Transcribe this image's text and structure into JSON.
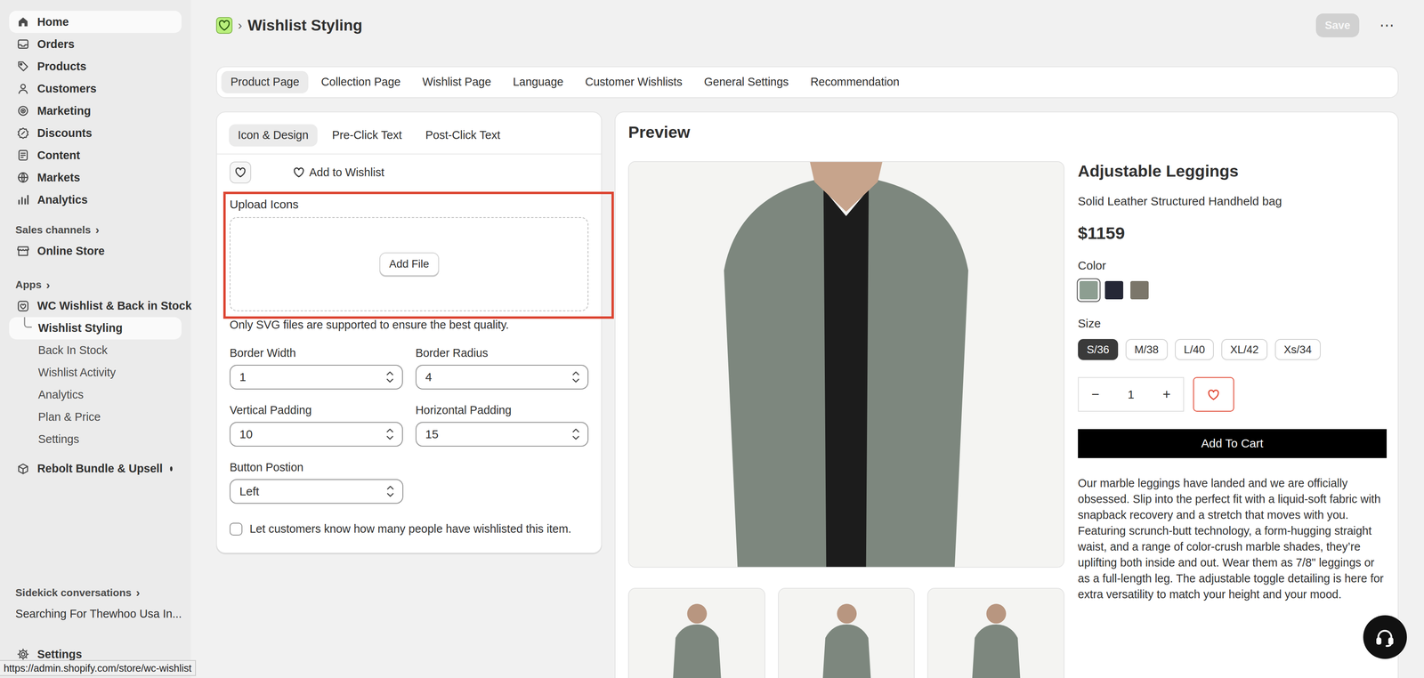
{
  "sidebar": {
    "main": [
      {
        "label": "Home",
        "hovered": true
      },
      {
        "label": "Orders",
        "hovered": false
      },
      {
        "label": "Products",
        "hovered": false
      },
      {
        "label": "Customers",
        "hovered": false
      },
      {
        "label": "Marketing",
        "hovered": false
      },
      {
        "label": "Discounts",
        "hovered": false
      },
      {
        "label": "Content",
        "hovered": false
      },
      {
        "label": "Markets",
        "hovered": false
      },
      {
        "label": "Analytics",
        "hovered": false
      }
    ],
    "sales_channels": {
      "label": "Sales channels",
      "chevron": "›",
      "items": [
        {
          "label": "Online Store"
        }
      ]
    },
    "apps": {
      "label": "Apps",
      "chevron": "›",
      "items": [
        {
          "label": "WC Wishlist & Back in Stock",
          "dot": false,
          "sub_items": [
            {
              "label": "Wishlist Styling",
              "selected": true
            },
            {
              "label": "Back In Stock",
              "selected": false
            },
            {
              "label": "Wishlist Activity",
              "selected": false
            },
            {
              "label": "Analytics",
              "selected": false
            },
            {
              "label": "Plan & Price",
              "selected": false
            },
            {
              "label": "Settings",
              "selected": false
            }
          ]
        },
        {
          "label": "Rebolt Bundle & Upsell",
          "dot": true,
          "sub_items": []
        }
      ]
    },
    "sidekick": {
      "label": "Sidekick conversations",
      "chevron": "›",
      "items": [
        {
          "label": "Searching For Thewhoo Usa In..."
        }
      ]
    },
    "settings": {
      "label": "Settings"
    }
  },
  "status_bar": {
    "url": "https://admin.shopify.com/store/wc-wishlist"
  },
  "header": {
    "separator": "›",
    "title": "Wishlist Styling",
    "save": {
      "label": "Save",
      "disabled": true
    },
    "more": "⋯"
  },
  "tabs": [
    {
      "label": "Product Page",
      "selected": true
    },
    {
      "label": "Collection Page",
      "selected": false
    },
    {
      "label": "Wishlist Page",
      "selected": false
    },
    {
      "label": "Language",
      "selected": false
    },
    {
      "label": "Customer Wishlists",
      "selected": false
    },
    {
      "label": "General Settings",
      "selected": false
    },
    {
      "label": "Recommendation",
      "selected": false
    }
  ],
  "editor": {
    "subtabs": [
      {
        "label": "Icon & Design",
        "selected": true
      },
      {
        "label": "Pre-Click Text",
        "selected": false
      },
      {
        "label": "Post-Click Text",
        "selected": false
      }
    ],
    "styles": [
      {
        "kind": "icon",
        "label": "",
        "selected": true
      },
      {
        "kind": "icon-text",
        "label": "Add to Wishlist",
        "selected": false
      }
    ],
    "upload": {
      "label": "Upload Icons",
      "button": "Add File",
      "hint": "Only SVG files are supported to ensure the best quality.",
      "highlighted": true
    },
    "fields": [
      {
        "label": "Border Width",
        "value": "1"
      },
      {
        "label": "Border Radius",
        "value": "4"
      },
      {
        "label": "Vertical Padding",
        "value": "10"
      },
      {
        "label": "Horizontal Padding",
        "value": "15"
      }
    ],
    "position": {
      "label": "Button Postion",
      "value": "Left"
    },
    "show_count": {
      "label": "Let customers know how many people have wishlisted this item.",
      "checked": false
    }
  },
  "preview": {
    "title": "Preview",
    "product": {
      "name": "Adjustable Leggings",
      "subtitle": "Solid Leather Structured Handheld bag",
      "price": "$1159",
      "color_label": "Color",
      "colors": [
        {
          "color": "#8d9e91",
          "selected": true
        },
        {
          "color": "#252736",
          "selected": false
        },
        {
          "color": "#7b766a",
          "selected": false
        }
      ],
      "size_label": "Size",
      "sizes": [
        {
          "label": "S/36",
          "selected": true
        },
        {
          "label": "M/38",
          "selected": false
        },
        {
          "label": "L/40",
          "selected": false
        },
        {
          "label": "XL/42",
          "selected": false
        },
        {
          "label": "Xs/34",
          "selected": false
        }
      ],
      "quantity": {
        "minus": "−",
        "value": "1",
        "plus": "+"
      },
      "add_to_cart": "Add To Cart",
      "description": "Our marble leggings have landed and we are officially obsessed. Slip into the perfect fit with a liquid-soft fabric with snapback recovery and a stretch that moves with you. Featuring scrunch-butt technology, a form-hugging straight waist, and a range of color-crush marble shades, they’re uplifting both inside and out. Wear them as 7/8\" leggings or as a full-length leg. The adjustable toggle detailing is here for extra versatility to match your height and your mood."
    }
  }
}
